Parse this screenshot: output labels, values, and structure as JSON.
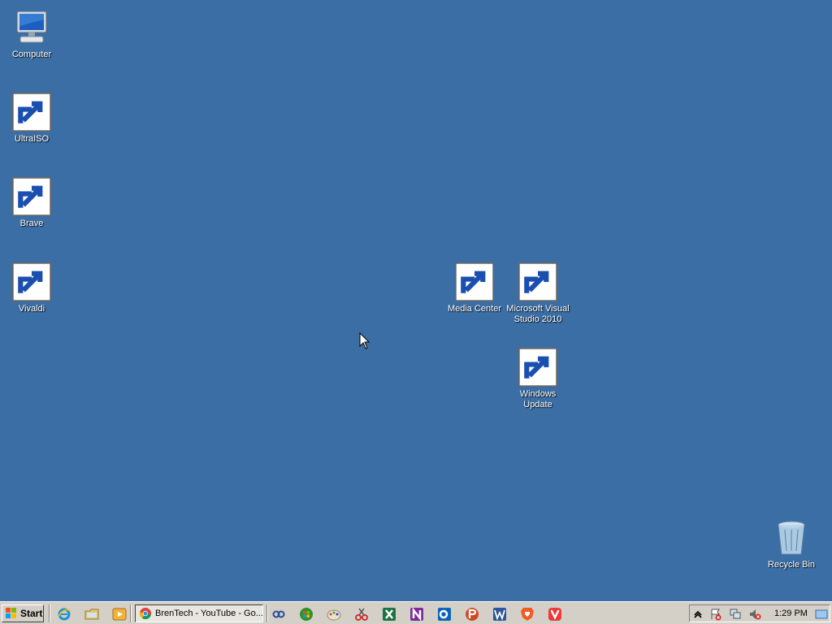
{
  "desktop": {
    "icons": [
      {
        "label": "Computer",
        "icon": "computer-icon"
      },
      {
        "label": "UltraISO",
        "icon": "disc-icon"
      },
      {
        "label": "Brave",
        "icon": "brave-lion-icon"
      },
      {
        "label": "Vivaldi",
        "icon": "vivaldi-icon"
      },
      {
        "label": "Media Center",
        "icon": "media-center-icon"
      },
      {
        "label": "Microsoft Visual Studio 2010",
        "icon": "visual-studio-icon"
      },
      {
        "label": "Windows Update",
        "icon": "windows-update-icon"
      },
      {
        "label": "Recycle Bin",
        "icon": "recycle-bin-icon"
      }
    ]
  },
  "taskbar": {
    "start_label": "Start",
    "active_window": "BrenTech - YouTube - Go...",
    "quick_launch": [
      "internet-explorer-icon",
      "file-explorer-icon",
      "media-player-icon"
    ],
    "pinned": [
      "link-icon",
      "windows-media-center-icon",
      "paint-icon",
      "snipping-icon",
      "excel-icon",
      "onenote-icon",
      "outlook-icon",
      "powerpoint-icon",
      "word-icon",
      "brave-icon",
      "vivaldi-icon"
    ],
    "clock": "1:29 PM"
  },
  "colors": {
    "desktop_bg": "#3a6ea5",
    "taskbar_bg": "#d4d0c8"
  }
}
